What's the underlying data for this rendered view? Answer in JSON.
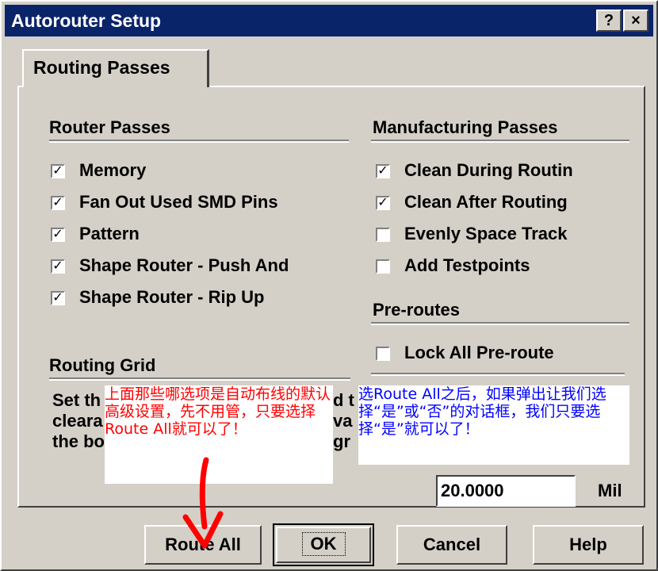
{
  "window": {
    "title": "Autorouter Setup",
    "help_btn": "?",
    "close_btn": "×"
  },
  "tab": {
    "label": "Routing Passes"
  },
  "router_passes": {
    "title": "Router Passes",
    "items": [
      {
        "label": "Memory",
        "checked": true
      },
      {
        "label": "Fan Out Used SMD Pins",
        "checked": true
      },
      {
        "label": "Pattern",
        "checked": true
      },
      {
        "label": "Shape Router - Push And",
        "checked": true
      },
      {
        "label": "Shape Router - Rip Up",
        "checked": true
      }
    ]
  },
  "manufacturing_passes": {
    "title": "Manufacturing Passes",
    "items": [
      {
        "label": "Clean During Routin",
        "checked": true
      },
      {
        "label": "Clean After Routing",
        "checked": true
      },
      {
        "label": "Evenly Space Track",
        "checked": false
      },
      {
        "label": "Add Testpoints",
        "checked": false
      }
    ]
  },
  "pre_routes": {
    "title": "Pre-routes",
    "lock_label": "Lock All Pre-route",
    "lock_checked": false
  },
  "routing_grid": {
    "title": "Routing Grid",
    "text_line1": "Set th",
    "text_line1_b": "d t",
    "text_line2": "cleara",
    "text_line2_b": "va",
    "text_line3": "the bo",
    "text_line3_b": "gr",
    "value": "20.0000",
    "unit": "Mil"
  },
  "annotations": {
    "red_note": "上面那些哪选项是自动布线的默认高级设置，先不用管，只要选择Route All就可以了！",
    "blue_note": "选Route All之后，如果弹出让我们选择“是”或“否”的对话框，我们只要选择“是”就可以了！"
  },
  "buttons": {
    "route_all": "Route All",
    "ok": "OK",
    "cancel": "Cancel",
    "help": "Help"
  },
  "colors": {
    "titlebar": "#0a246a",
    "face": "#d4d0c8",
    "red_note": "#ff0000",
    "blue_note": "#0000ff"
  }
}
